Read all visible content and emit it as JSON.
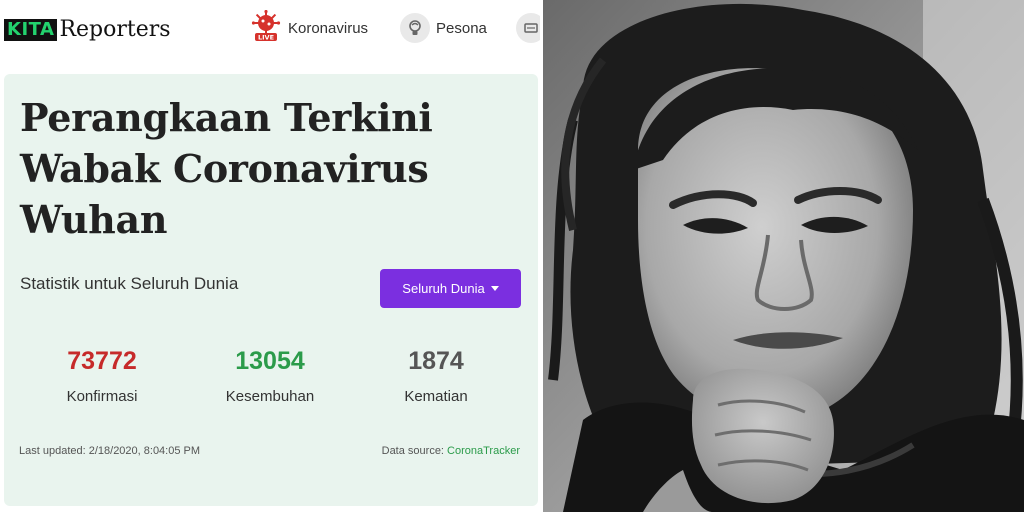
{
  "brand": {
    "kita": "KITA",
    "reporters": "Reporters"
  },
  "nav": {
    "items": [
      {
        "label": "Koronavirus",
        "icon": "virus-live-icon",
        "badge": "LIVE"
      },
      {
        "label": "Pesona",
        "icon": "pesona-icon"
      },
      {
        "label": "",
        "icon": "menu-icon"
      }
    ]
  },
  "hero": {
    "title_lines": [
      "Perangkaan Terkini",
      "Wabak Coronavirus",
      "Wuhan"
    ],
    "subtitle": "Statistik untuk Seluruh Dunia",
    "region_button": "Seluruh Dunia"
  },
  "stats": {
    "confirmed": {
      "value": "73772",
      "label": "Konfirmasi",
      "color": "#c62a2a"
    },
    "recovered": {
      "value": "13054",
      "label": "Kesembuhan",
      "color": "#2b9b4a"
    },
    "deaths": {
      "value": "1874",
      "label": "Kematian",
      "color": "#555555"
    }
  },
  "footer": {
    "last_updated": "Last updated: 2/18/2020, 8:04:05 PM",
    "source_prefix": "Data source: ",
    "source_name": "CoronaTracker"
  },
  "colors": {
    "card_bg": "#e9f4ee",
    "accent_purple": "#7b2fe0",
    "logo_green": "#23d36e",
    "live_red": "#d6322c"
  }
}
